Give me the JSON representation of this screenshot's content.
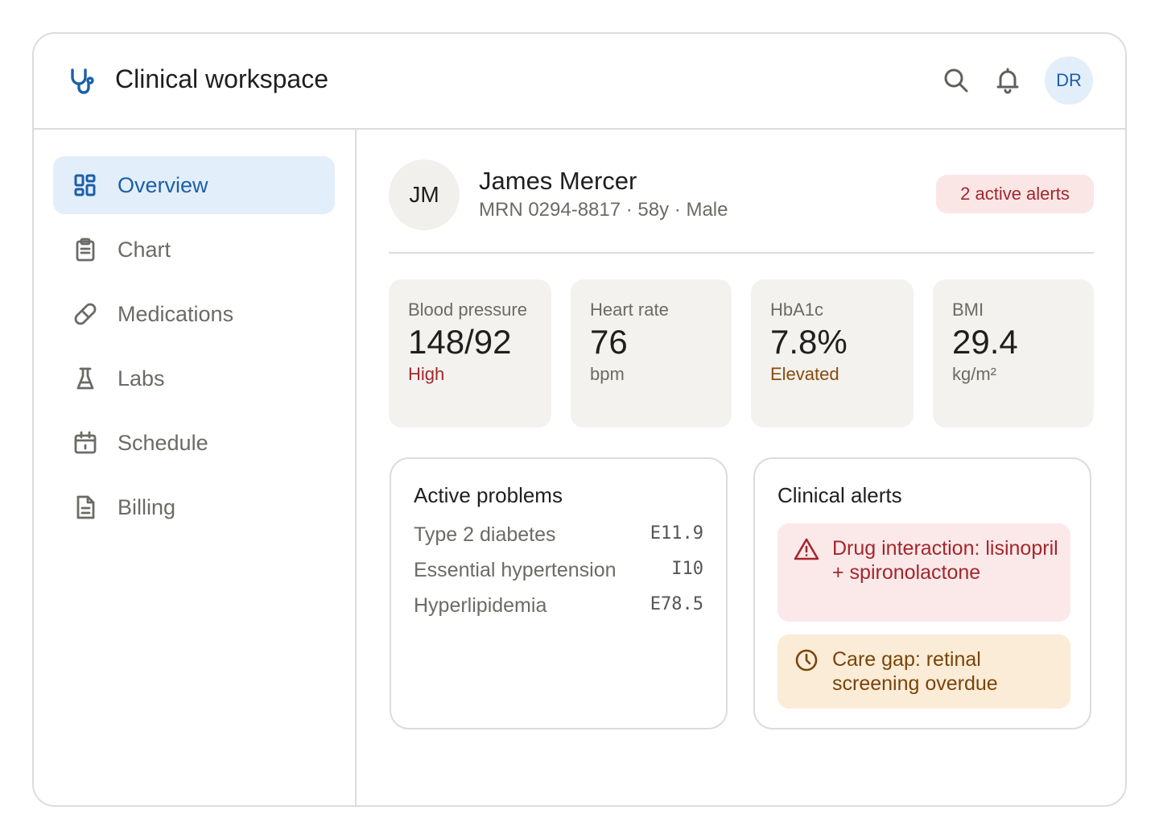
{
  "header": {
    "app_title": "Clinical workspace",
    "logo_icon": "stethoscope-icon",
    "user_initials": "DR"
  },
  "sidebar": {
    "items": [
      {
        "label": "Overview",
        "icon": "grid-icon",
        "active": true
      },
      {
        "label": "Chart",
        "icon": "clipboard-icon",
        "active": false
      },
      {
        "label": "Medications",
        "icon": "pill-icon",
        "active": false
      },
      {
        "label": "Labs",
        "icon": "flask-icon",
        "active": false
      },
      {
        "label": "Schedule",
        "icon": "calendar-icon",
        "active": false
      },
      {
        "label": "Billing",
        "icon": "invoice-icon",
        "active": false
      }
    ]
  },
  "patient": {
    "initials": "JM",
    "name": "James Mercer",
    "meta": "MRN 0294-8817 · 58y · Male",
    "alert_badge": "2 active alerts"
  },
  "vitals": [
    {
      "label": "Blood pressure",
      "value": "148/92",
      "sub": "High",
      "status": "high"
    },
    {
      "label": "Heart rate",
      "value": "76",
      "sub": "bpm",
      "status": "unit"
    },
    {
      "label": "HbA1c",
      "value": "7.8%",
      "sub": "Elevated",
      "status": "elevated"
    },
    {
      "label": "BMI",
      "value": "29.4",
      "sub": "kg/m²",
      "status": "unit"
    }
  ],
  "problems": {
    "title": "Active problems",
    "items": [
      {
        "name": "Type 2 diabetes",
        "code": "E11.9"
      },
      {
        "name": "Essential hypertension",
        "code": "I10"
      },
      {
        "name": "Hyperlipidemia",
        "code": "E78.5"
      }
    ]
  },
  "alerts": {
    "title": "Clinical alerts",
    "items": [
      {
        "text": "Drug interaction: lisinopril + spironolactone",
        "severity": "danger",
        "icon": "warning-triangle-icon"
      },
      {
        "text": "Care gap: retinal screening overdue",
        "severity": "warning",
        "icon": "clock-icon"
      }
    ]
  },
  "colors": {
    "accent": "#1c5fa8",
    "accent_bg": "#e3eefb",
    "danger": "#a4262c",
    "danger_bg": "#fbe9e9",
    "warning": "#7a4409",
    "warning_bg": "#fbecd7",
    "card_bg": "#f3f2ee"
  }
}
